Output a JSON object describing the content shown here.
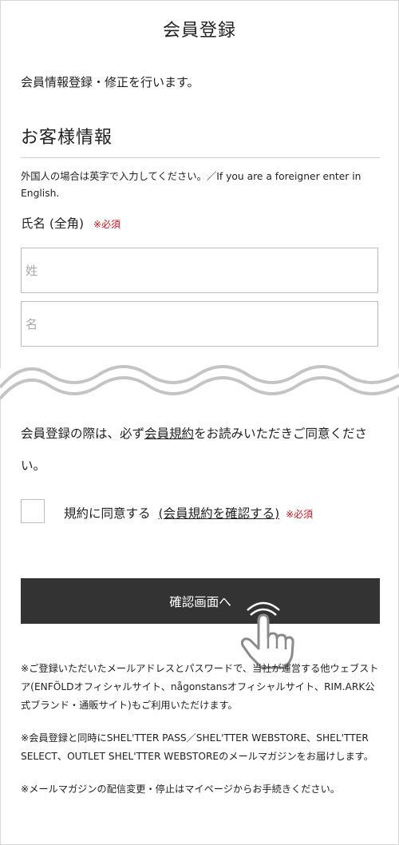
{
  "page": {
    "title": "会員登録",
    "intro": "会員情報登録・修正を行います。"
  },
  "customer_info": {
    "heading": "お客様情報",
    "foreigner_note": "外国人の場合は英字で入力してください。／If you are a foreigner enter in English.",
    "name_label": "氏名 (全角)",
    "required_mark": "※必須",
    "surname_placeholder": "姓",
    "given_name_placeholder": "名"
  },
  "agreement": {
    "text_before": "会員登録の際は、必ず",
    "terms_link": "会員規約",
    "text_after": "をお読みいただきご同意ください。",
    "checkbox_label": "規約に同意する",
    "confirm_link": "(会員規約を確認する)",
    "required_mark": "※必須"
  },
  "submit": {
    "label": "確認画面へ"
  },
  "notes": [
    "※ご登録いただいたメールアドレスとパスワードで、当社が運営する他ウェブストア(ENFÖLDオフィシャルサイト、någonstansオフィシャルサイト、RIM.ARK公式ブランド・通販サイト)もご利用いただけます。",
    "※会員登録と同時にSHEL'TTER PASS／SHEL'TTER WEBSTORE、SHEL'TTER SELECT、OUTLET SHEL'TTER WEBSTOREのメールマガジンをお届けします。",
    "※メールマガジンの配信変更・停止はマイページからお手続きください。"
  ],
  "colors": {
    "button_bg": "#333333",
    "required": "#c0141c",
    "wave": "#c4c4c4"
  },
  "icons": {
    "pointer": "hand-pointer-icon"
  }
}
